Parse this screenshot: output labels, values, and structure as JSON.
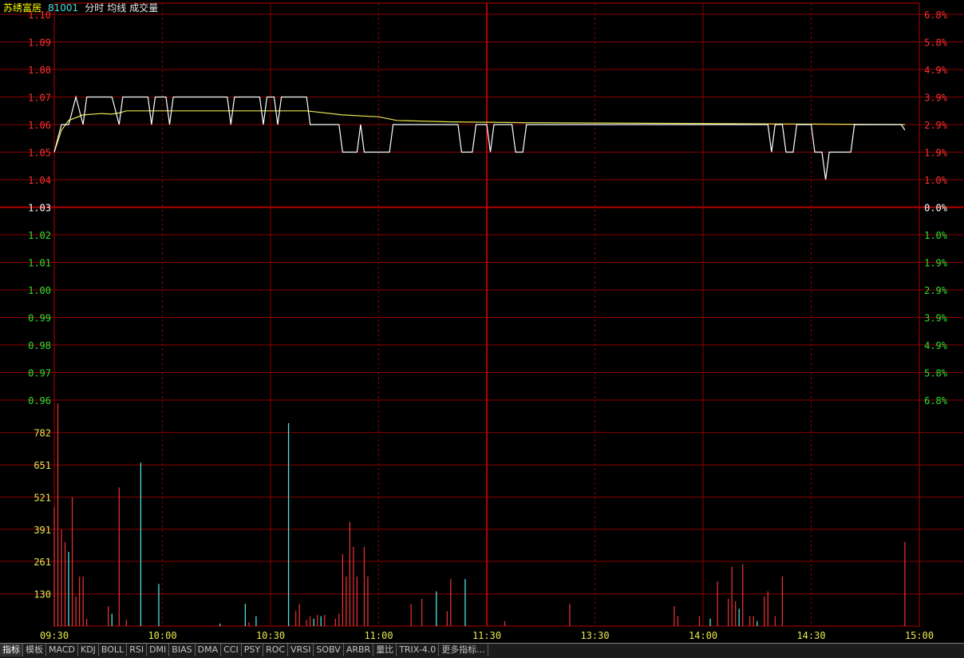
{
  "header": {
    "stock_name": "苏绣富居",
    "stock_code": "81001",
    "mode_label": "分时",
    "avg_label": "均线",
    "volume_label": "成交量"
  },
  "colors": {
    "grid": "#8a0000",
    "grid_major": "#b40000",
    "price_line": "#ffffff",
    "avg_line": "#e6e650",
    "up_label": "#ff3030",
    "down_label": "#30e030",
    "flat_label": "#ffffff",
    "volume_up": "#e03030",
    "volume_down": "#50e0e0",
    "volume_label": "#e8e850",
    "time_label": "#e8e850",
    "stock_name": "#ffff00",
    "stock_code": "#40e0e0",
    "header_text": "#e8e8e8"
  },
  "chart_data": {
    "type": "line",
    "price_axis": {
      "ticks": [
        "1.10",
        "1.09",
        "1.08",
        "1.07",
        "1.06",
        "1.05",
        "1.04",
        "1.03",
        "1.02",
        "1.01",
        "1.00",
        "0.99",
        "0.98",
        "0.97",
        "0.96"
      ],
      "range": [
        0.96,
        1.1
      ],
      "prev_close": 1.03
    },
    "pct_axis": {
      "ticks": [
        "6.8%",
        "5.8%",
        "4.9%",
        "3.9%",
        "2.9%",
        "1.9%",
        "1.0%",
        "0.0%",
        "1.0%",
        "1.9%",
        "2.9%",
        "3.9%",
        "4.9%",
        "5.8%",
        "6.8%"
      ]
    },
    "volume_axis": {
      "ticks": [
        "782",
        "651",
        "521",
        "391",
        "261",
        "130"
      ],
      "range": [
        0,
        913
      ]
    },
    "time_ticks": [
      "09:30",
      "10:00",
      "10:30",
      "11:00",
      "11:30",
      "13:30",
      "14:00",
      "14:30",
      "15:00"
    ],
    "price_series": [
      [
        0,
        1.05
      ],
      [
        2,
        1.06
      ],
      [
        4,
        1.06
      ],
      [
        6,
        1.07
      ],
      [
        8,
        1.06
      ],
      [
        9,
        1.07
      ],
      [
        16,
        1.07
      ],
      [
        18,
        1.06
      ],
      [
        19,
        1.07
      ],
      [
        26,
        1.07
      ],
      [
        27,
        1.06
      ],
      [
        28,
        1.07
      ],
      [
        31,
        1.07
      ],
      [
        32,
        1.06
      ],
      [
        33,
        1.07
      ],
      [
        48,
        1.07
      ],
      [
        49,
        1.06
      ],
      [
        50,
        1.07
      ],
      [
        57,
        1.07
      ],
      [
        58,
        1.06
      ],
      [
        59,
        1.07
      ],
      [
        61,
        1.07
      ],
      [
        62,
        1.06
      ],
      [
        63,
        1.07
      ],
      [
        70,
        1.07
      ],
      [
        71,
        1.06
      ],
      [
        79,
        1.06
      ],
      [
        80,
        1.05
      ],
      [
        84,
        1.05
      ],
      [
        85,
        1.06
      ],
      [
        86,
        1.05
      ],
      [
        93,
        1.05
      ],
      [
        94,
        1.06
      ],
      [
        112,
        1.06
      ],
      [
        113,
        1.05
      ],
      [
        116,
        1.05
      ],
      [
        117,
        1.06
      ],
      [
        120,
        1.06
      ],
      [
        121,
        1.05
      ],
      [
        122,
        1.06
      ],
      [
        127,
        1.06
      ],
      [
        128,
        1.05
      ],
      [
        130,
        1.05
      ],
      [
        131,
        1.06
      ],
      [
        198,
        1.06
      ],
      [
        199,
        1.05
      ],
      [
        200,
        1.06
      ],
      [
        202,
        1.06
      ],
      [
        203,
        1.05
      ],
      [
        205,
        1.05
      ],
      [
        206,
        1.06
      ],
      [
        210,
        1.06
      ],
      [
        211,
        1.05
      ],
      [
        213,
        1.05
      ],
      [
        214,
        1.04
      ],
      [
        215,
        1.05
      ],
      [
        221,
        1.05
      ],
      [
        222,
        1.06
      ],
      [
        235,
        1.06
      ],
      [
        236,
        1.058
      ]
    ],
    "avg_series": [
      [
        0,
        1.05
      ],
      [
        2,
        1.058
      ],
      [
        4,
        1.0615
      ],
      [
        8,
        1.0635
      ],
      [
        13,
        1.064
      ],
      [
        16,
        1.0638
      ],
      [
        18,
        1.0642
      ],
      [
        20,
        1.065
      ],
      [
        70,
        1.065
      ],
      [
        80,
        1.0635
      ],
      [
        90,
        1.0628
      ],
      [
        95,
        1.0615
      ],
      [
        110,
        1.061
      ],
      [
        130,
        1.0607
      ],
      [
        236,
        1.06
      ]
    ],
    "volume_bars": [
      [
        0,
        480,
        "u"
      ],
      [
        1,
        900,
        "u"
      ],
      [
        2,
        390,
        "u"
      ],
      [
        3,
        340,
        "u"
      ],
      [
        4,
        300,
        "d"
      ],
      [
        5,
        520,
        "u"
      ],
      [
        6,
        120,
        "u"
      ],
      [
        7,
        200,
        "u"
      ],
      [
        8,
        200,
        "u"
      ],
      [
        9,
        30,
        "u"
      ],
      [
        15,
        80,
        "u"
      ],
      [
        16,
        50,
        "d"
      ],
      [
        18,
        560,
        "u"
      ],
      [
        20,
        25,
        "u"
      ],
      [
        24,
        660,
        "d"
      ],
      [
        29,
        170,
        "d"
      ],
      [
        46,
        10,
        "d"
      ],
      [
        53,
        90,
        "d"
      ],
      [
        54,
        15,
        "u"
      ],
      [
        56,
        40,
        "d"
      ],
      [
        65,
        820,
        "d"
      ],
      [
        67,
        60,
        "u"
      ],
      [
        68,
        90,
        "u"
      ],
      [
        70,
        25,
        "u"
      ],
      [
        71,
        40,
        "u"
      ],
      [
        72,
        30,
        "d"
      ],
      [
        73,
        45,
        "u"
      ],
      [
        74,
        40,
        "d"
      ],
      [
        75,
        45,
        "u"
      ],
      [
        78,
        30,
        "u"
      ],
      [
        79,
        50,
        "u"
      ],
      [
        80,
        290,
        "u"
      ],
      [
        81,
        200,
        "u"
      ],
      [
        82,
        420,
        "u"
      ],
      [
        83,
        320,
        "u"
      ],
      [
        84,
        200,
        "u"
      ],
      [
        86,
        320,
        "u"
      ],
      [
        87,
        200,
        "u"
      ],
      [
        99,
        90,
        "u"
      ],
      [
        102,
        110,
        "u"
      ],
      [
        106,
        140,
        "d"
      ],
      [
        109,
        60,
        "u"
      ],
      [
        110,
        190,
        "u"
      ],
      [
        114,
        190,
        "d"
      ],
      [
        125,
        20,
        "u"
      ],
      [
        143,
        90,
        "u"
      ],
      [
        172,
        80,
        "u"
      ],
      [
        173,
        40,
        "u"
      ],
      [
        179,
        40,
        "u"
      ],
      [
        182,
        30,
        "d"
      ],
      [
        184,
        180,
        "u"
      ],
      [
        187,
        110,
        "u"
      ],
      [
        188,
        240,
        "u"
      ],
      [
        189,
        100,
        "u"
      ],
      [
        190,
        70,
        "d"
      ],
      [
        191,
        250,
        "u"
      ],
      [
        193,
        40,
        "u"
      ],
      [
        194,
        40,
        "u"
      ],
      [
        195,
        20,
        "d"
      ],
      [
        197,
        120,
        "u"
      ],
      [
        198,
        140,
        "u"
      ],
      [
        200,
        40,
        "u"
      ],
      [
        202,
        200,
        "u"
      ],
      [
        236,
        340,
        "u"
      ]
    ]
  },
  "tabs": [
    "指标",
    "模板",
    "MACD",
    "KDJ",
    "BOLL",
    "RSI",
    "DMI",
    "BIAS",
    "DMA",
    "CCI",
    "PSY",
    "ROC",
    "VRSI",
    "SOBV",
    "ARBR",
    "量比",
    "TRIX-4.0",
    "更多指标..."
  ]
}
